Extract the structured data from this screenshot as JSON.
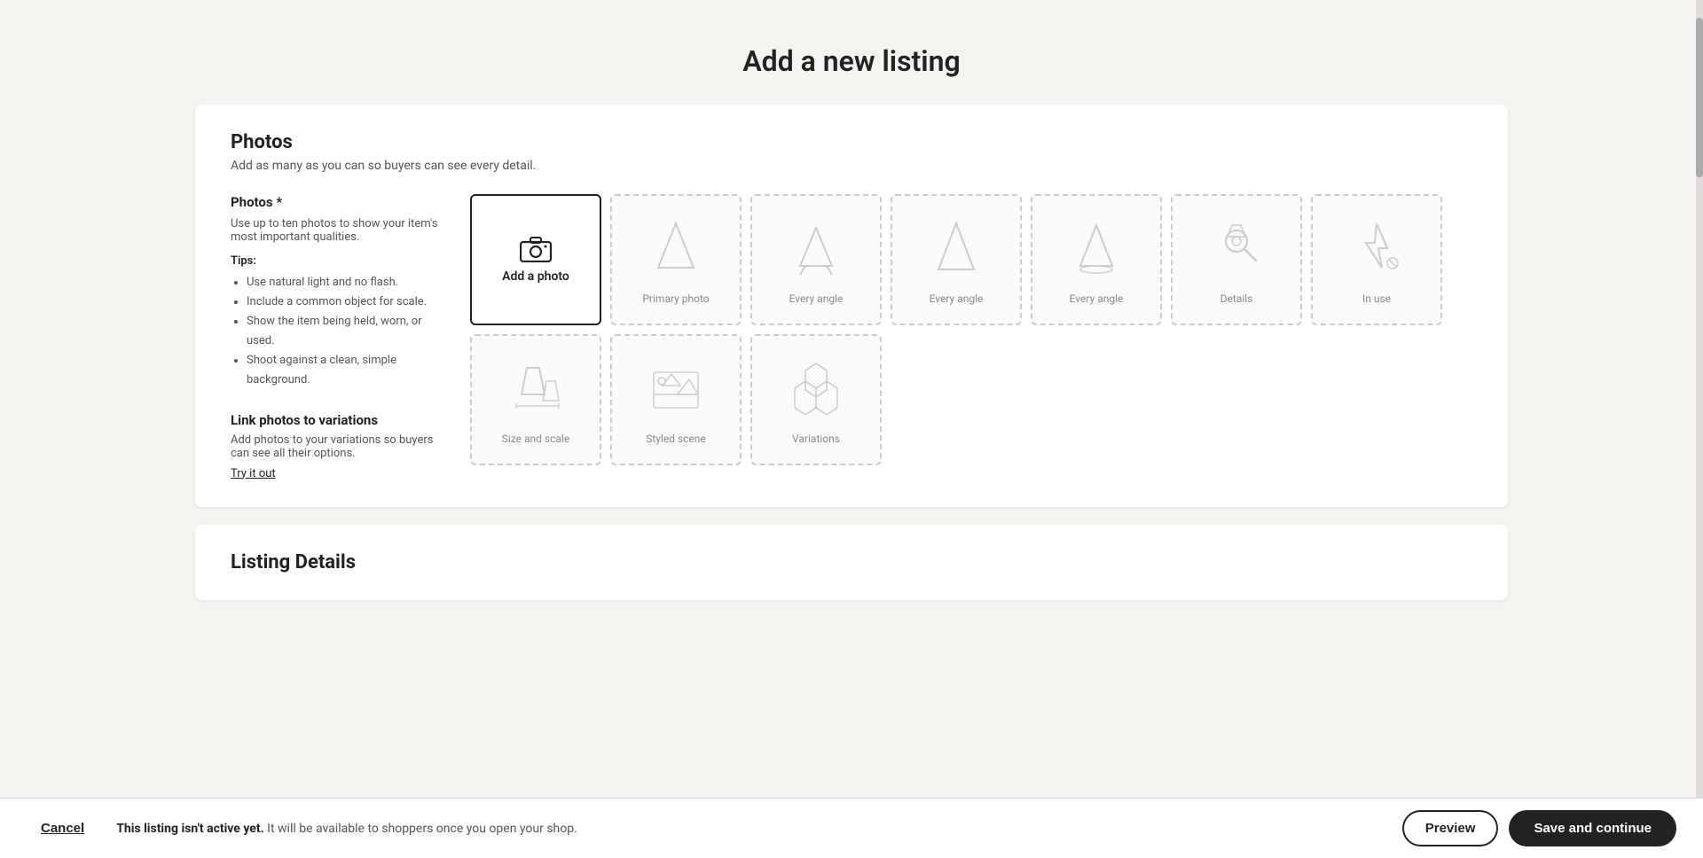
{
  "page": {
    "title": "Add a new listing"
  },
  "photos_section": {
    "title": "Photos",
    "subtitle": "Add as many as you can so buyers can see every detail.",
    "photos_label": "Photos *",
    "photos_description": "Use up to ten photos to show your item's most important qualities.",
    "tips_label": "Tips:",
    "tips": [
      "Use natural light and no flash.",
      "Include a common object for scale.",
      "Show the item being held, worn, or used.",
      "Shoot against a clean, simple background."
    ],
    "link_photos_title": "Link photos to variations",
    "link_photos_desc": "Add photos to your variations so buyers can see all their options.",
    "try_link": "Try it out",
    "add_photo_label": "Add a photo",
    "slots": [
      {
        "label": "Primary photo",
        "type": "primary"
      },
      {
        "label": "Every angle",
        "type": "every_angle"
      },
      {
        "label": "Every angle",
        "type": "every_angle"
      },
      {
        "label": "Every angle",
        "type": "every_angle"
      },
      {
        "label": "Details",
        "type": "details"
      },
      {
        "label": "In use",
        "type": "in_use"
      },
      {
        "label": "Size and scale",
        "type": "size_scale"
      },
      {
        "label": "Styled scene",
        "type": "styled_scene"
      },
      {
        "label": "Variations",
        "type": "variations"
      }
    ]
  },
  "listing_details": {
    "title": "Listing Details"
  },
  "bottom_bar": {
    "cancel_label": "Cancel",
    "notice_bold": "This listing isn't active yet.",
    "notice_text": " It will be available to shoppers once you open your shop.",
    "preview_label": "Preview",
    "save_label": "Save and continue"
  }
}
